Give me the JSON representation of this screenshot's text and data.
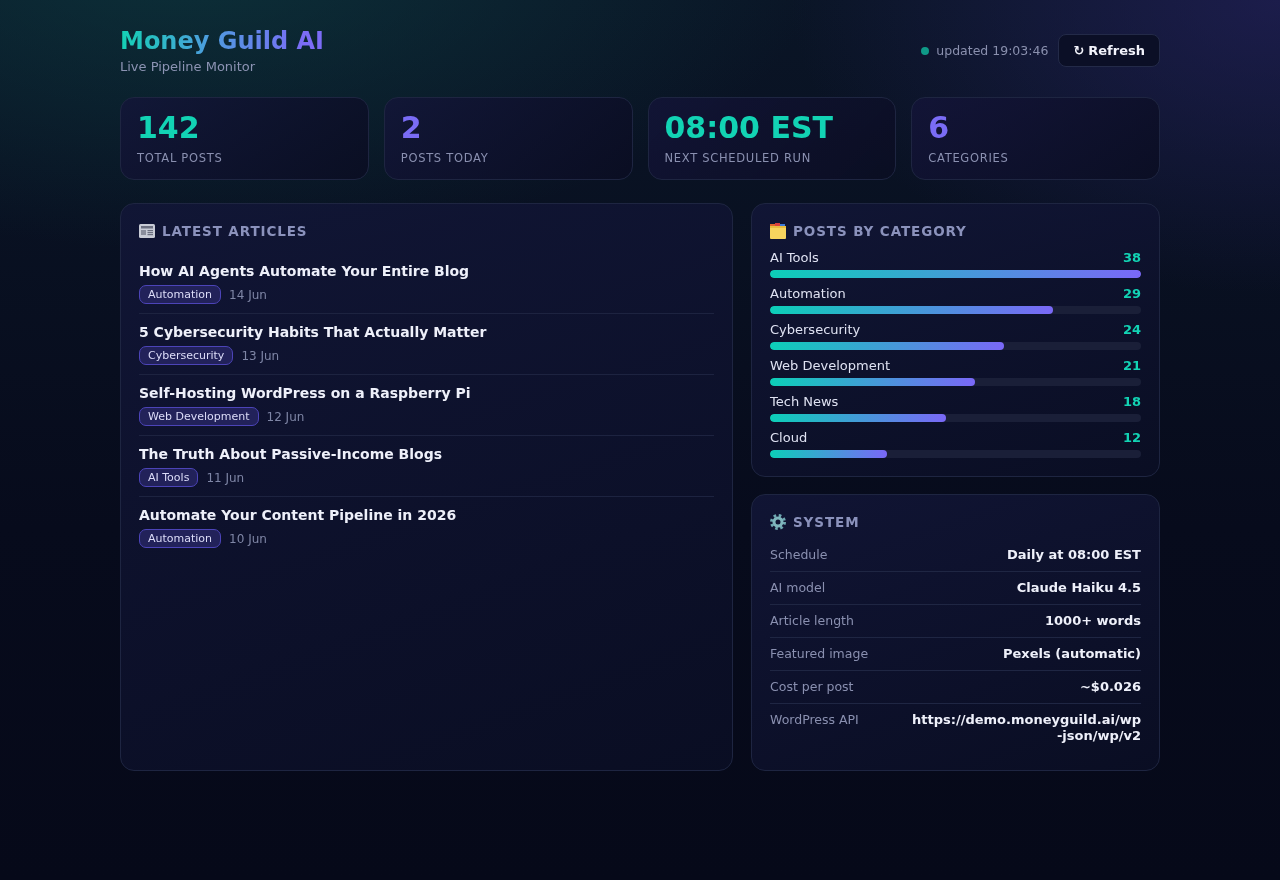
{
  "header": {
    "title": "Money Guild AI",
    "subtitle": "Live Pipeline Monitor",
    "status": {
      "text": "updated 19:03:46"
    },
    "refresh_button": {
      "icon": "↻",
      "label": "Refresh"
    }
  },
  "stats": [
    {
      "value": "142",
      "label": "TOTAL POSTS"
    },
    {
      "value": "2",
      "label": "POSTS TODAY"
    },
    {
      "value": "08:00 EST",
      "label": "NEXT SCHEDULED RUN"
    },
    {
      "value": "6",
      "label": "CATEGORIES"
    }
  ],
  "latest_articles": {
    "title": "LATEST ARTICLES",
    "articles": [
      {
        "title": "How AI Agents Automate Your Entire Blog",
        "tag": "Automation",
        "date": "14 Jun"
      },
      {
        "title": "5 Cybersecurity Habits That Actually Matter",
        "tag": "Cybersecurity",
        "date": "13 Jun"
      },
      {
        "title": "Self-Hosting WordPress on a Raspberry Pi",
        "tag": "Web Development",
        "date": "12 Jun"
      },
      {
        "title": "The Truth About Passive-Income Blogs",
        "tag": "AI Tools",
        "date": "11 Jun"
      },
      {
        "title": "Automate Your Content Pipeline in 2026",
        "tag": "Automation",
        "date": "10 Jun"
      }
    ]
  },
  "posts_by_category": {
    "title": "POSTS BY CATEGORY",
    "categories": [
      {
        "name": "AI Tools",
        "count": "38",
        "level": 1.0
      },
      {
        "name": "Automation",
        "count": "29",
        "level": 0.763
      },
      {
        "name": "Cybersecurity",
        "count": "24",
        "level": 0.632
      },
      {
        "name": "Web Development",
        "count": "21",
        "level": 0.553
      },
      {
        "name": "Tech News",
        "count": "18",
        "level": 0.474
      },
      {
        "name": "Cloud",
        "count": "12",
        "level": 0.316
      }
    ]
  },
  "system": {
    "title": "SYSTEM",
    "rows": [
      {
        "label": "Schedule",
        "value": "Daily at 08:00 EST"
      },
      {
        "label": "AI model",
        "value": "Claude Haiku 4.5"
      },
      {
        "label": "Article length",
        "value": "1000+ words"
      },
      {
        "label": "Featured image",
        "value": "Pexels (automatic)"
      },
      {
        "label": "Cost per post",
        "value": "~$0.026"
      },
      {
        "label": "WordPress API",
        "value": "https://demo.moneyguild.ai/wp-json/wp/v2"
      }
    ]
  }
}
